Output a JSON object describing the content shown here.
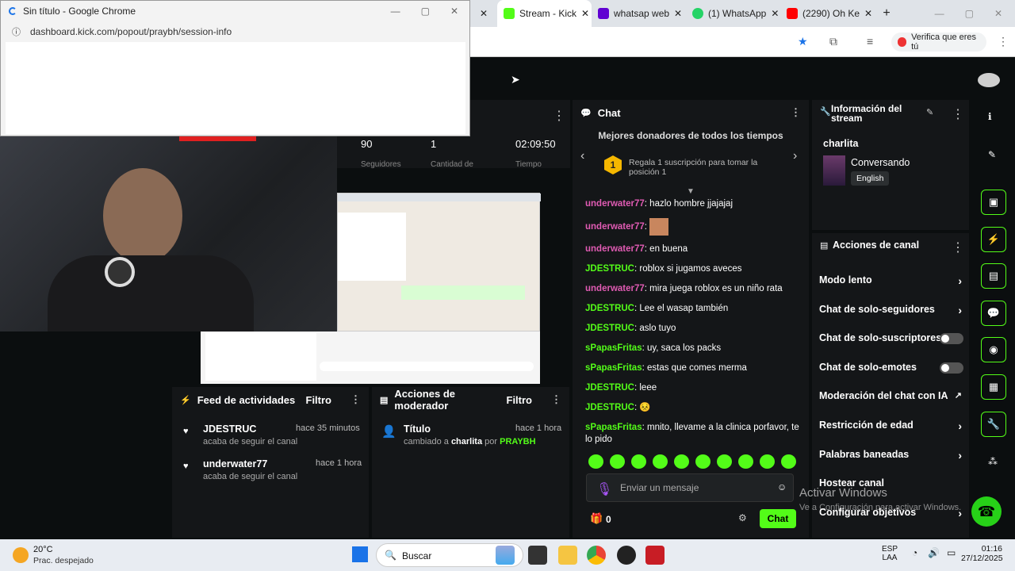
{
  "popup": {
    "title": "Sin título - Google Chrome",
    "url": "dashboard.kick.com/popout/praybh/session-info"
  },
  "tabs": [
    {
      "label": "Stream - Kick",
      "color": "#53fc18"
    },
    {
      "label": "whatsap web",
      "color": "#6001d2"
    },
    {
      "label": "(1) WhatsApp",
      "color": "#25d366"
    },
    {
      "label": "(2290) Oh Ke",
      "color": "#ff0000"
    }
  ],
  "verify_label": "Verifica que eres tú",
  "stats": {
    "v1": "90",
    "v2": "1",
    "v3": "02:09:50",
    "l1": "Seguidores",
    "l2": "Cantidad de",
    "l3": "Tiempo"
  },
  "feed": {
    "title": "Feed de actividades",
    "filter": "Filtro",
    "items": [
      {
        "user": "JDESTRUC",
        "time": "hace 35 minutos",
        "desc": "acaba de seguir el canal"
      },
      {
        "user": "underwater77",
        "time": "hace 1 hora",
        "desc": "acaba de seguir el canal"
      }
    ]
  },
  "mod": {
    "title": "Acciones de moderador",
    "filter": "Filtro",
    "item_title": "Título",
    "time": "hace 1 hora",
    "changed": "cambiado a",
    "target": "charlita",
    "by": "por",
    "mod_user": "PRAYBH"
  },
  "chat": {
    "title": "Chat",
    "donors_title": "Mejores donadores de todos los tiempos",
    "donor_rank": "1",
    "donor_text": "Regala 1 suscripción para tomar la posición 1",
    "messages": [
      {
        "user": "underwater77",
        "text": "hazlo hombre jjajajaj",
        "cls": "user1"
      },
      {
        "user": "underwater77",
        "text": "",
        "cls": "user1",
        "emote": true
      },
      {
        "user": "underwater77",
        "text": "en buena",
        "cls": "user1"
      },
      {
        "user": "JDESTRUC",
        "text": "roblox si jugamos aveces",
        "cls": "user2"
      },
      {
        "user": "underwater77",
        "text": "mira juega roblox es un niño rata",
        "cls": "user1"
      },
      {
        "user": "JDESTRUC",
        "text": "Lee el wasap también",
        "cls": "user2"
      },
      {
        "user": "JDESTRUC",
        "text": "aslo tuyo",
        "cls": "user2"
      },
      {
        "user": "sPapasFritas",
        "text": "uy, saca los packs",
        "cls": "user2"
      },
      {
        "user": "sPapasFritas",
        "text": "estas que comes merma",
        "cls": "user2"
      },
      {
        "user": "JDESTRUC",
        "text": "leee",
        "cls": "user2"
      },
      {
        "user": "JDESTRUC",
        "text": "😣",
        "cls": "user2"
      },
      {
        "user": "sPapasFritas",
        "text": "mnito, llevame a la clinica porfavor, te lo pido",
        "cls": "user2"
      }
    ],
    "placeholder": "Enviar un mensaje",
    "points": "0",
    "send": "Chat"
  },
  "info": {
    "title": "Información del stream",
    "channel": "charlita",
    "category": "Conversando",
    "language": "English"
  },
  "actions": {
    "title": "Acciones de canal",
    "items": [
      "Modo lento",
      "Chat de solo-seguidores",
      "Chat de solo-suscriptores",
      "Chat de solo-emotes",
      "Moderación del chat con IA",
      "Restricción de edad",
      "Palabras baneadas",
      "Hostear canal",
      "Configurar objetivos"
    ]
  },
  "watermark": {
    "line1": "Activar Windows",
    "line2": "Ve a Configuración para activar Windows."
  },
  "taskbar": {
    "weather_temp": "20°C",
    "weather_desc": "Prac. despejado",
    "search": "Buscar",
    "lang1": "ESP",
    "lang2": "LAA",
    "time": "01:16",
    "date": "27/12/2025"
  }
}
